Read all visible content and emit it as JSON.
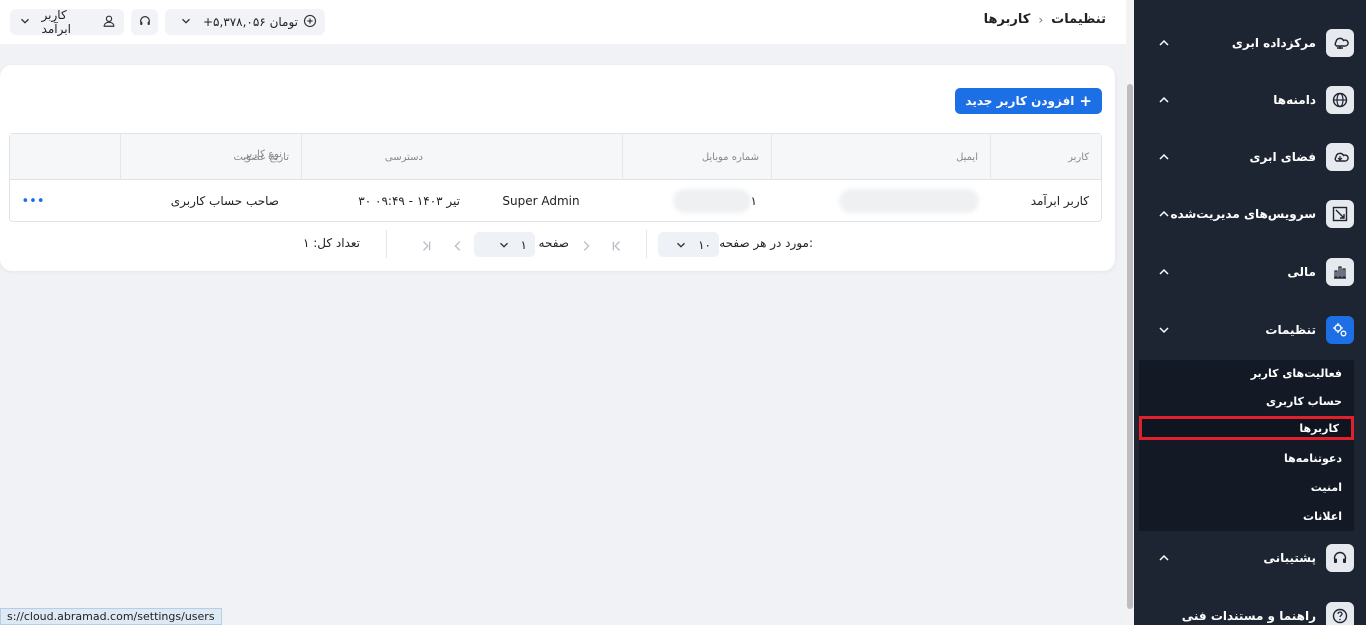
{
  "breadcrumb": {
    "parent": "تنظیمات",
    "separator": "›",
    "current": "کاربرها"
  },
  "topbar": {
    "user_label": "کاربر ابرآمد",
    "balance": "+۵,۳۷۸,۰۵۶ تومان"
  },
  "sidebar": {
    "items": [
      {
        "label": "مرکزداده ابری",
        "icon": "cloud-server-icon"
      },
      {
        "label": "دامنه‌ها",
        "icon": "globe-icon"
      },
      {
        "label": "فضای ابری",
        "icon": "cloud-storage-icon"
      },
      {
        "label": "سرویس‌های مدیریت‌شده",
        "icon": "managed-services-icon"
      },
      {
        "label": "مالی",
        "icon": "finance-chart-icon"
      },
      {
        "label": "تنظیمات",
        "icon": "settings-gears-icon"
      },
      {
        "label": "پشتیبانی",
        "icon": "headset-icon"
      },
      {
        "label": "راهنما و مستندات فنی",
        "icon": "help-docs-icon"
      }
    ],
    "submenu": [
      "فعالیت‌های کاربر",
      "حساب کاربری",
      "کاربرها",
      "دعوتنامه‌ها",
      "امنیت",
      "اعلانات"
    ]
  },
  "card": {
    "add_button": "افزودن کاربر جدید",
    "add_icon": "+"
  },
  "table": {
    "columns": [
      "کاربر",
      "ایمیل",
      "شماره موبایل",
      "دسترسی",
      "تاریخ عضویت",
      "نوع کاربر"
    ],
    "rows": [
      {
        "user": "کاربر ابرآمد",
        "mobile_partial": "۱",
        "access": "Super Admin",
        "joined": "۳۰ تیر ۱۴۰۳ - ۰۹:۴۹",
        "type": "صاحب حساب کاربری",
        "menu": "•••"
      }
    ]
  },
  "pagination": {
    "per_page_label": "مورد در هر صفحه:",
    "per_page_value": "۱۰",
    "page_label": "صفحه",
    "page_value": "۱",
    "total_label": "تعداد کل: ۱"
  },
  "status_url": "s://cloud.abramad.com/settings/users",
  "colors": {
    "sidebar_bg": "#1d2532",
    "accent": "#1d6fe6",
    "highlight": "#e2202c"
  }
}
